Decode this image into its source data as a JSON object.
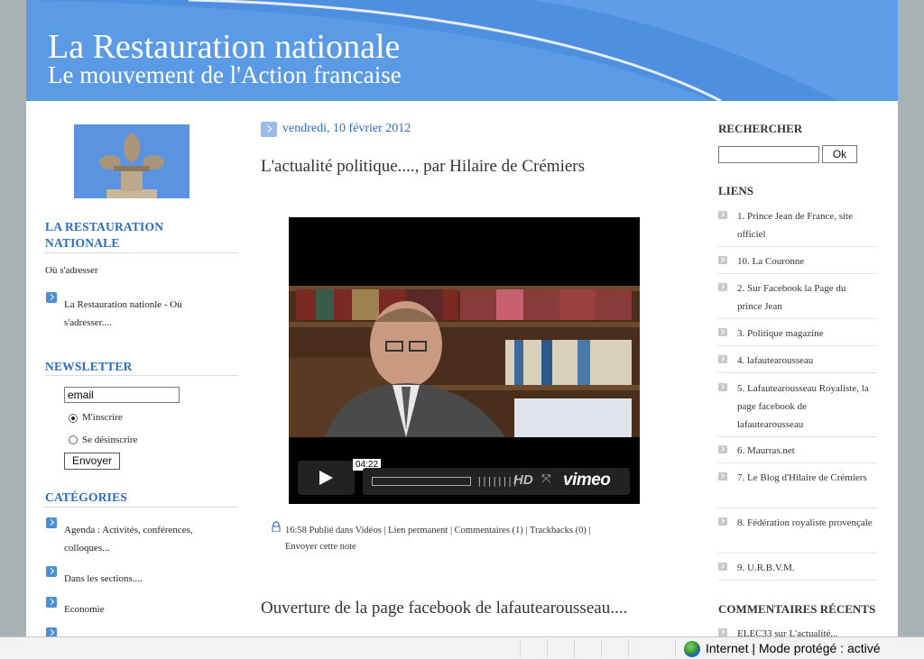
{
  "header": {
    "title": "La Restauration nationale",
    "subtitle": "Le mouvement de l'Action francaise"
  },
  "left_sidebar": {
    "section1_title": "LA RESTAURATION NATIONALE",
    "address_label": "Où s'adresser",
    "address_link": "La Restauration nationle - Où s'adresser....",
    "newsletter_title": "NEWSLETTER",
    "email_value": "email",
    "subscribe_label": "M'inscrire",
    "unsubscribe_label": "Se désinscrire",
    "send_label": "Envoyer",
    "categories_title": "CATÉGORIES",
    "categories": [
      "Agenda : Activités, conférences, colloques...",
      "Dans les sections....",
      "Economie"
    ]
  },
  "main": {
    "date": "vendredi, 10 février 2012",
    "post_title": "L'actualité politique...., par Hilaire de Crémiers",
    "video": {
      "time": "04:22",
      "hd_label": "HD",
      "brand": "vimeo"
    },
    "meta_line1": "16:58 Publié dans Vidéos | Lien permanent | Commentaires (1) | Trackbacks (0) |",
    "meta_line2": "Envoyer cette note",
    "post2_title": "Ouverture de la page facebook de lafautearousseau...."
  },
  "right_sidebar": {
    "search_title": "RECHERCHER",
    "ok_label": "Ok",
    "links_title": "LIENS",
    "links": [
      "1. Prince Jean de France, site officiel",
      "10. La Couronne",
      "2. Sur Facebook la Page du prince Jean",
      "3. Politique magazine",
      "4. lafautearousseau",
      "5. Lafautearousseau Royaliste, la page facebook de lafautearousseau",
      "6. Maurras.net",
      "7. Le Blog d'Hilaire de Crémiers",
      "8. Fédération royaliste provençale",
      "9. U.R.B.V.M."
    ],
    "comments_title": "COMMENTAIRES RÉCENTS",
    "comments_partial": "ELEC33 sur L'actualité..."
  },
  "statusbar": {
    "text": "Internet | Mode protégé : activé"
  }
}
